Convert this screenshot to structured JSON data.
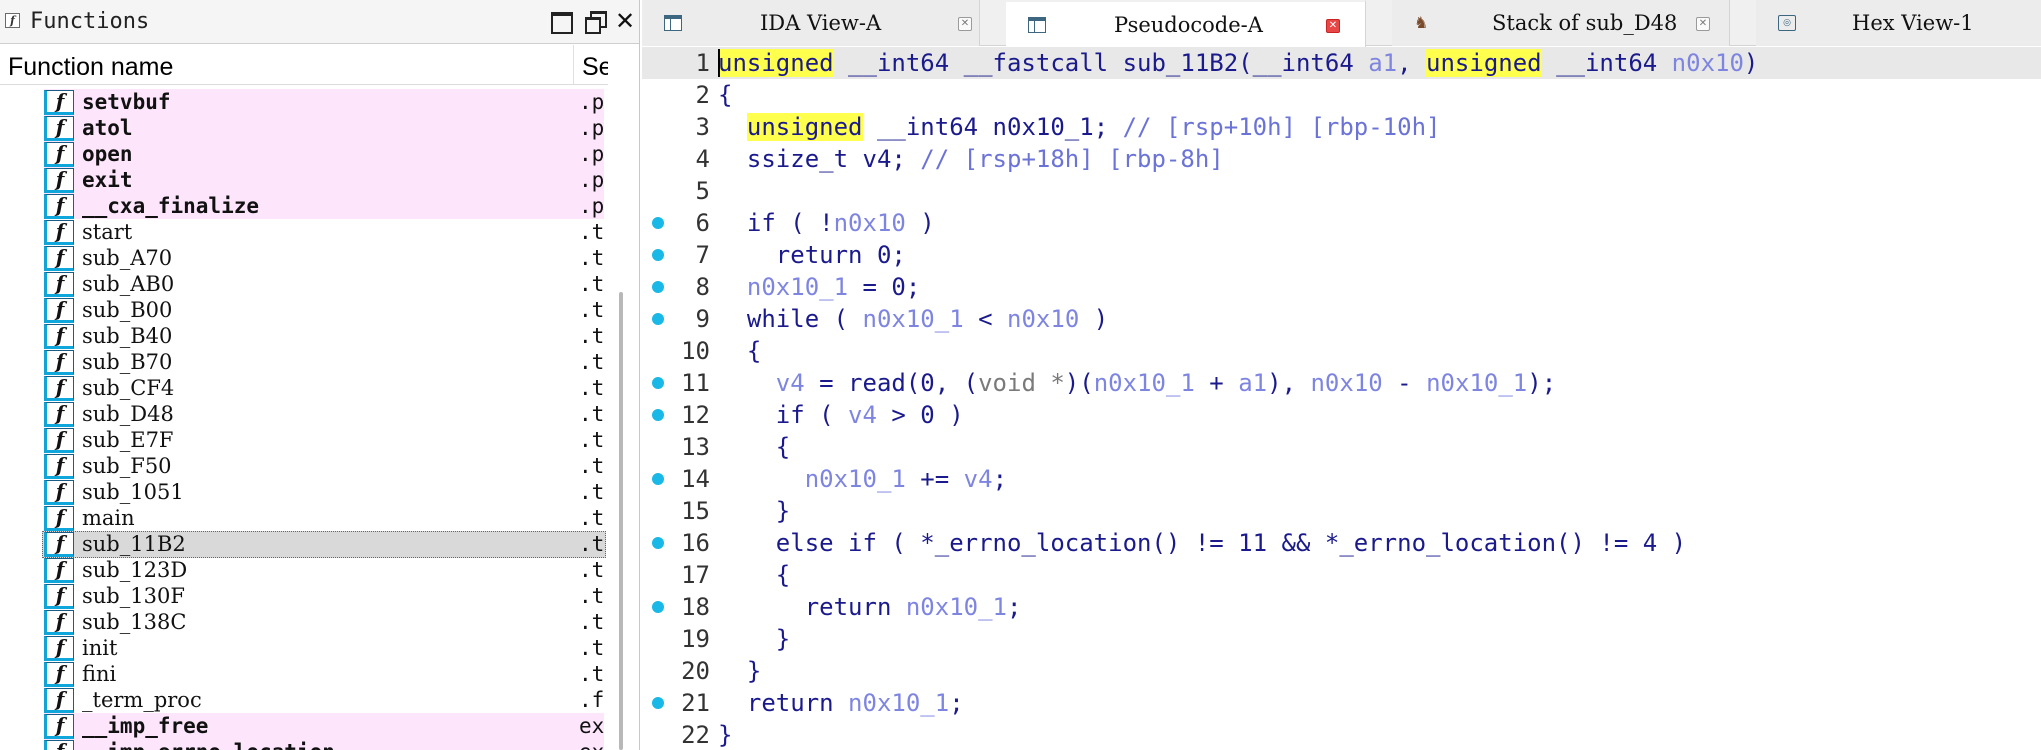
{
  "functions_panel": {
    "title": "Functions",
    "col_name": "Function name",
    "col_segment": "Se",
    "rows": [
      {
        "name": "setvbuf",
        "seg": ".p",
        "imp": true
      },
      {
        "name": "atol",
        "seg": ".p",
        "imp": true
      },
      {
        "name": "open",
        "seg": ".p",
        "imp": true
      },
      {
        "name": "exit",
        "seg": ".p",
        "imp": true
      },
      {
        "name": "__cxa_finalize",
        "seg": ".p",
        "imp": true
      },
      {
        "name": "start",
        "seg": ".t"
      },
      {
        "name": "sub_A70",
        "seg": ".t"
      },
      {
        "name": "sub_AB0",
        "seg": ".t"
      },
      {
        "name": "sub_B00",
        "seg": ".t"
      },
      {
        "name": "sub_B40",
        "seg": ".t"
      },
      {
        "name": "sub_B70",
        "seg": ".t"
      },
      {
        "name": "sub_CF4",
        "seg": ".t"
      },
      {
        "name": "sub_D48",
        "seg": ".t"
      },
      {
        "name": "sub_E7F",
        "seg": ".t"
      },
      {
        "name": "sub_F50",
        "seg": ".t"
      },
      {
        "name": "sub_1051",
        "seg": ".t"
      },
      {
        "name": "main",
        "seg": ".t"
      },
      {
        "name": "sub_11B2",
        "seg": ".t",
        "sel": true
      },
      {
        "name": "sub_123D",
        "seg": ".t"
      },
      {
        "name": "sub_130F",
        "seg": ".t"
      },
      {
        "name": "sub_138C",
        "seg": ".t"
      },
      {
        "name": "init",
        "seg": ".t"
      },
      {
        "name": "fini",
        "seg": ".t"
      },
      {
        "name": "_term_proc",
        "seg": ".f"
      },
      {
        "name": "__imp_free",
        "seg": "ex",
        "imp": true
      },
      {
        "name": "__imp_errno_location",
        "seg": "ex",
        "imp": true
      }
    ]
  },
  "tabs": [
    {
      "label": "IDA View-A",
      "active": false
    },
    {
      "label": "Pseudocode-A",
      "active": true
    },
    {
      "label": "Stack of sub_D48",
      "active": false
    },
    {
      "label": "Hex View-1",
      "active": false
    }
  ],
  "code_lines": [
    {
      "n": "1",
      "bp": false,
      "html": "<span class='hl'>unsigned</span> __int64 __fastcall sub_11B2(__int64 <span class='arg'>a1</span>, <span class='hl'>unsigned</span> __int64 <span class='arg'>n0x10</span>)"
    },
    {
      "n": "2",
      "bp": false,
      "html": "{"
    },
    {
      "n": "3",
      "bp": false,
      "html": "  <span class='hl'>unsigned</span> __int64 n0x10_1; <span class='cm'>// [rsp+10h] [rbp-10h]</span>"
    },
    {
      "n": "4",
      "bp": false,
      "html": "  ssize_t v4; <span class='cm'>// [rsp+18h] [rbp-8h]</span>"
    },
    {
      "n": "5",
      "bp": false,
      "html": ""
    },
    {
      "n": "6",
      "bp": true,
      "html": "  if ( !<span class='var'>n0x10</span> )"
    },
    {
      "n": "7",
      "bp": true,
      "html": "    return 0;"
    },
    {
      "n": "8",
      "bp": true,
      "html": "  <span class='var'>n0x10_1</span> = 0;"
    },
    {
      "n": "9",
      "bp": true,
      "html": "  while ( <span class='var'>n0x10_1</span> &lt; <span class='var'>n0x10</span> )"
    },
    {
      "n": "10",
      "bp": false,
      "html": "  {"
    },
    {
      "n": "11",
      "bp": true,
      "html": "    <span class='var'>v4</span> = read(0, (<span class='typ'>void *</span>)(<span class='var'>n0x10_1</span> + <span class='var'>a1</span>), <span class='var'>n0x10</span> - <span class='var'>n0x10_1</span>);"
    },
    {
      "n": "12",
      "bp": true,
      "html": "    if ( <span class='var'>v4</span> &gt; 0 )"
    },
    {
      "n": "13",
      "bp": false,
      "html": "    {"
    },
    {
      "n": "14",
      "bp": true,
      "html": "      <span class='var'>n0x10_1</span> += <span class='var'>v4</span>;"
    },
    {
      "n": "15",
      "bp": false,
      "html": "    }"
    },
    {
      "n": "16",
      "bp": true,
      "html": "    else if ( *_errno_location() != 11 &amp;&amp; *_errno_location() != 4 )"
    },
    {
      "n": "17",
      "bp": false,
      "html": "    {"
    },
    {
      "n": "18",
      "bp": true,
      "html": "      return <span class='var'>n0x10_1</span>;"
    },
    {
      "n": "19",
      "bp": false,
      "html": "    }"
    },
    {
      "n": "20",
      "bp": false,
      "html": "  }"
    },
    {
      "n": "21",
      "bp": true,
      "html": "  return <span class='var'>n0x10_1</span>;"
    },
    {
      "n": "22",
      "bp": false,
      "html": "}"
    }
  ],
  "colors": {
    "import_row_bg": "#fde6fc",
    "keyword_highlight": "#ffff4d",
    "breakpoint": "#1ab8e6",
    "code_text": "#1a1a8c",
    "variable": "#7e85e0"
  }
}
